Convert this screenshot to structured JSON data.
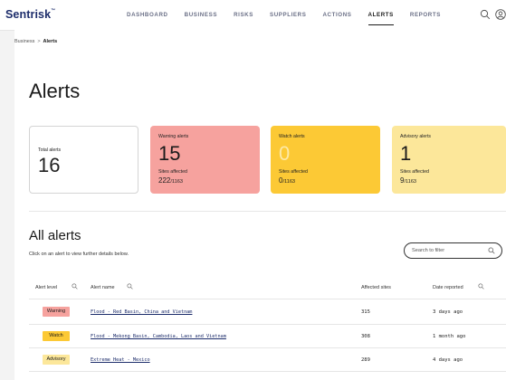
{
  "app": {
    "logo": "Sentrisk",
    "logo_mark": "™"
  },
  "nav": [
    {
      "label": "DASHBOARD",
      "active": false
    },
    {
      "label": "BUSINESS",
      "active": false
    },
    {
      "label": "RISKS",
      "active": false
    },
    {
      "label": "SUPPLIERS",
      "active": false
    },
    {
      "label": "ACTIONS",
      "active": false
    },
    {
      "label": "ALERTS",
      "active": true
    },
    {
      "label": "REPORTS",
      "active": false
    }
  ],
  "header_icons": [
    "search-icon",
    "user-icon"
  ],
  "breadcrumb": {
    "parent": "Business",
    "separator": ">",
    "current": "Alerts"
  },
  "page": {
    "title": "Alerts"
  },
  "summary": {
    "total": {
      "label": "Total alerts",
      "value": "16"
    },
    "warning": {
      "label": "Warning alerts",
      "value": "15",
      "sites_label": "Sites affected",
      "sites": "222",
      "sites_total": "/1163",
      "color": "#f6a29e"
    },
    "watch": {
      "label": "Watch alerts",
      "value": "0",
      "sites_label": "Sites affected",
      "sites": "0",
      "sites_total": "/1163",
      "color": "#fcc935"
    },
    "advisory": {
      "label": "Advisory alerts",
      "value": "1",
      "sites_label": "Sites affected",
      "sites": "9",
      "sites_total": "/1163",
      "color": "#fce79a"
    }
  },
  "all_alerts": {
    "title": "All alerts",
    "subtitle": "Click on an alert to view further details below.",
    "filter_placeholder": "Search to filter",
    "columns": {
      "level": "Alert level",
      "name": "Alert name",
      "sites": "Affected sites",
      "date": "Date reported"
    },
    "rows": [
      {
        "level": "Warning",
        "name": "Flood - Red Basin, China and Vietnam",
        "sites": "315",
        "date": "3 days ago"
      },
      {
        "level": "Watch",
        "name": "Flood - Mekong Basin, Cambodia, Laos and Vietnam",
        "sites": "308",
        "date": "1 month ago"
      },
      {
        "level": "Advisory",
        "name": "Extreme Heat - Mexico",
        "sites": "289",
        "date": "4 days ago"
      }
    ]
  }
}
